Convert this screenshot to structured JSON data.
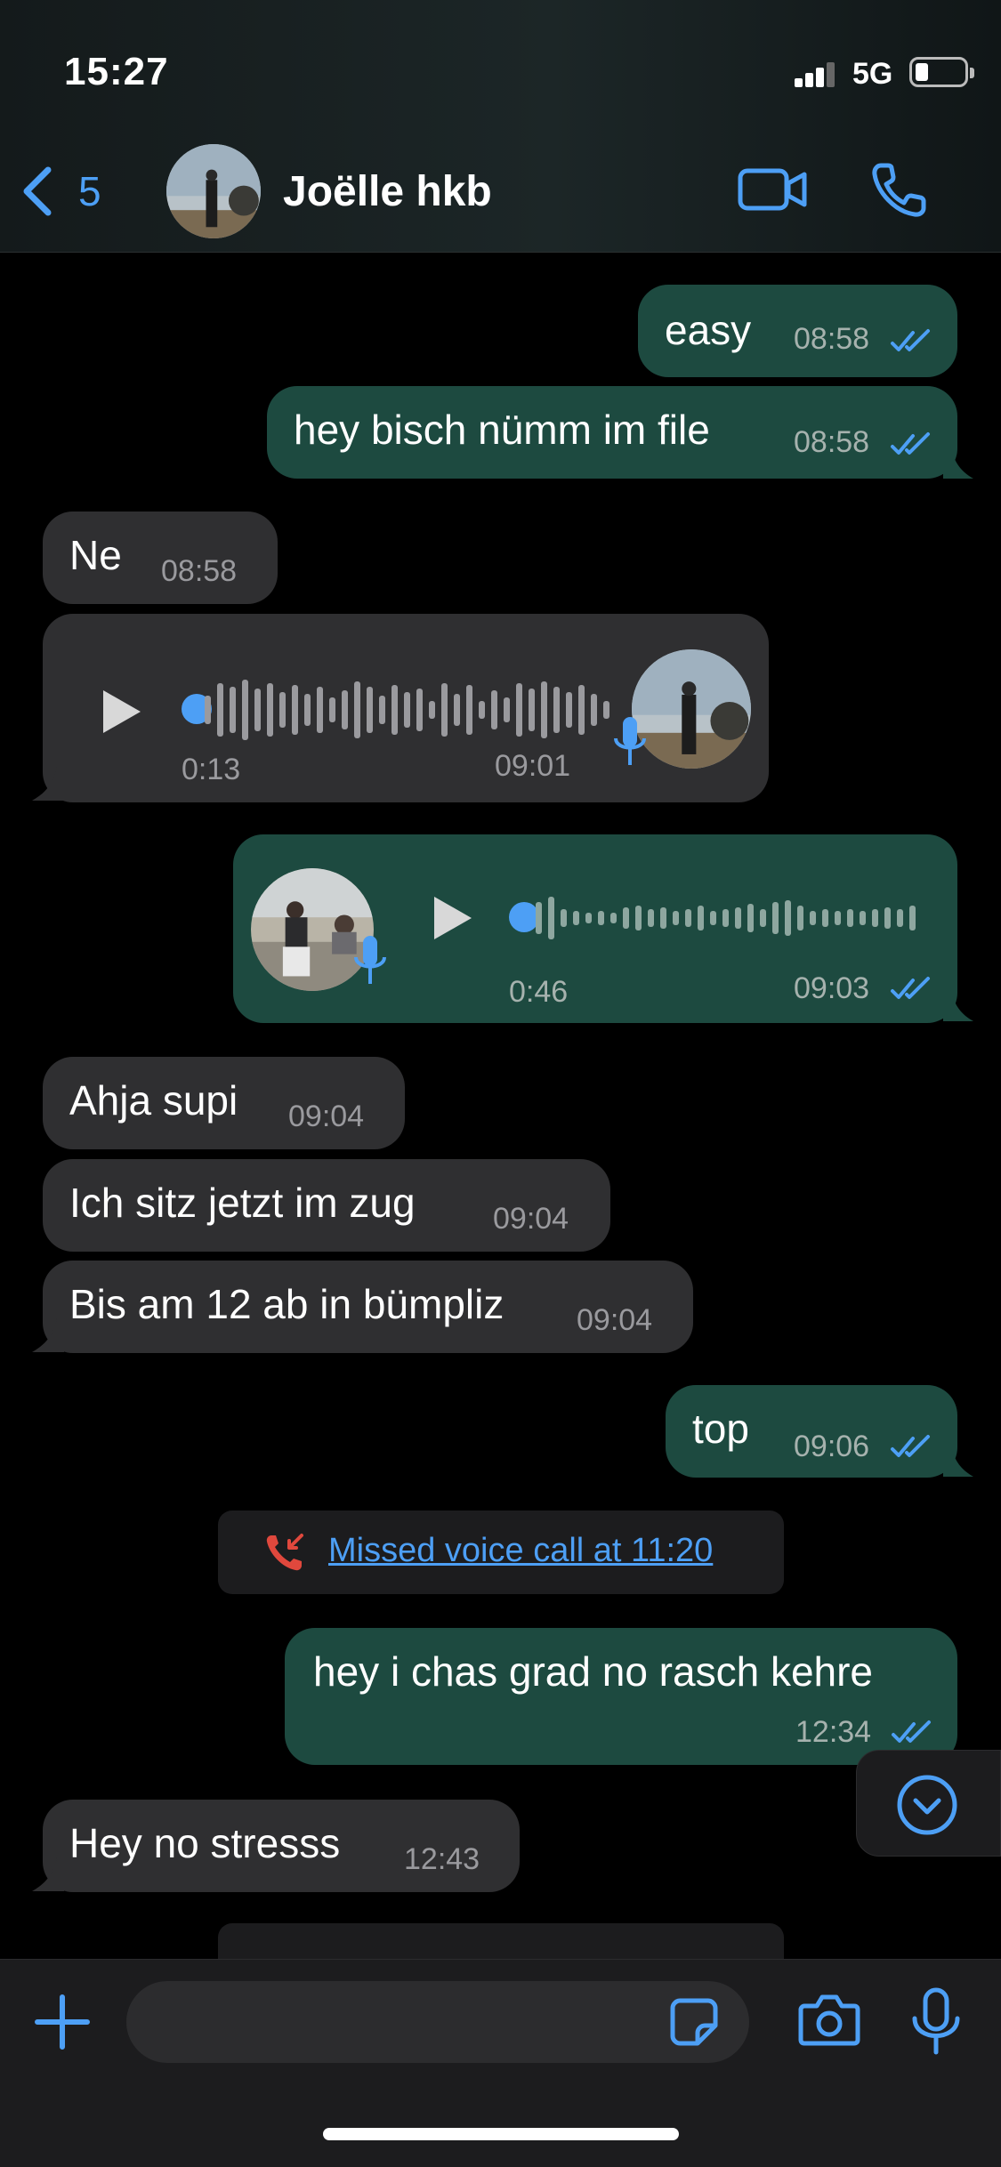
{
  "status_bar": {
    "time": "15:27",
    "network": "5G"
  },
  "header": {
    "back_count": "5",
    "contact_name": "Joëlle hkb"
  },
  "messages": [
    {
      "text": "easy",
      "time": "08:58"
    },
    {
      "text": "hey bisch nümm im file",
      "time": "08:58"
    },
    {
      "text": "Ne",
      "time": "08:58"
    },
    {
      "duration": "0:13",
      "time": "09:01"
    },
    {
      "duration": "0:46",
      "time": "09:03"
    },
    {
      "text": "Ahja supi",
      "time": "09:04"
    },
    {
      "text": "Ich sitz jetzt im zug",
      "time": "09:04"
    },
    {
      "text": "Bis am 12 ab in bümpliz",
      "time": "09:04"
    },
    {
      "text": "top",
      "time": "09:06"
    },
    {
      "text": "Missed voice call at 11:20"
    },
    {
      "text": "hey i chas grad no rasch kehre",
      "time": "12:34"
    },
    {
      "text": "Hey no stresss",
      "time": "12:43"
    }
  ],
  "colors": {
    "accent": "#4d9ff5",
    "outgoing_bubble": "#1d4a40",
    "incoming_bubble": "#2f2f31",
    "missed_call_icon": "#e0483d"
  }
}
